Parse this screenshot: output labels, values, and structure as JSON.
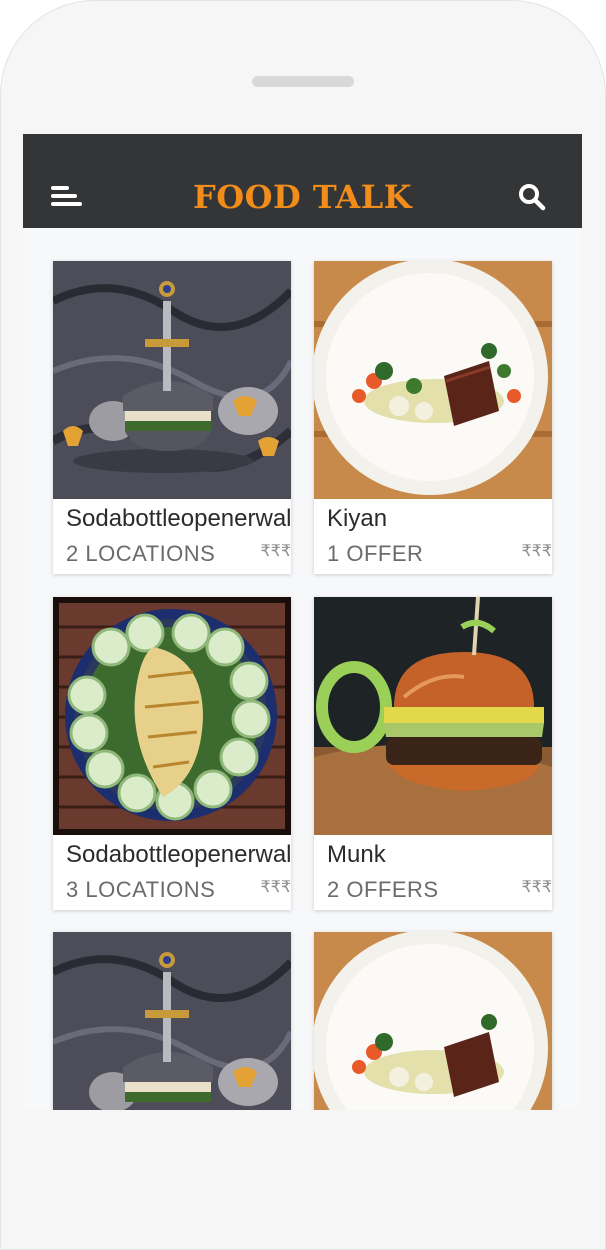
{
  "header": {
    "title": "FOOD TALK",
    "menu_icon": "hamburger-menu-icon",
    "search_icon": "search-icon",
    "background": "#333537",
    "title_color": "#f28c1a"
  },
  "restaurants": [
    {
      "name": "Sodabottleopenerwala",
      "meta": "2 LOCATIONS",
      "price": "₹₹₹",
      "image": "dark-burger-with-sword-photo"
    },
    {
      "name": "Kiyan",
      "meta": "1 OFFER",
      "price": "₹₹₹",
      "image": "plated-steak-dish-photo"
    },
    {
      "name": "Sodabottleopenerwala",
      "meta": "3 LOCATIONS",
      "price": "₹₹₹",
      "image": "grilled-fish-with-cucumbers-photo"
    },
    {
      "name": "Munk",
      "meta": "2 OFFERS",
      "price": "₹₹₹",
      "image": "burger-on-wooden-board-photo"
    },
    {
      "name": "",
      "meta": "",
      "price": "",
      "image": "dark-burger-with-sword-photo"
    },
    {
      "name": "",
      "meta": "",
      "price": "",
      "image": "plated-steak-dish-photo"
    }
  ]
}
